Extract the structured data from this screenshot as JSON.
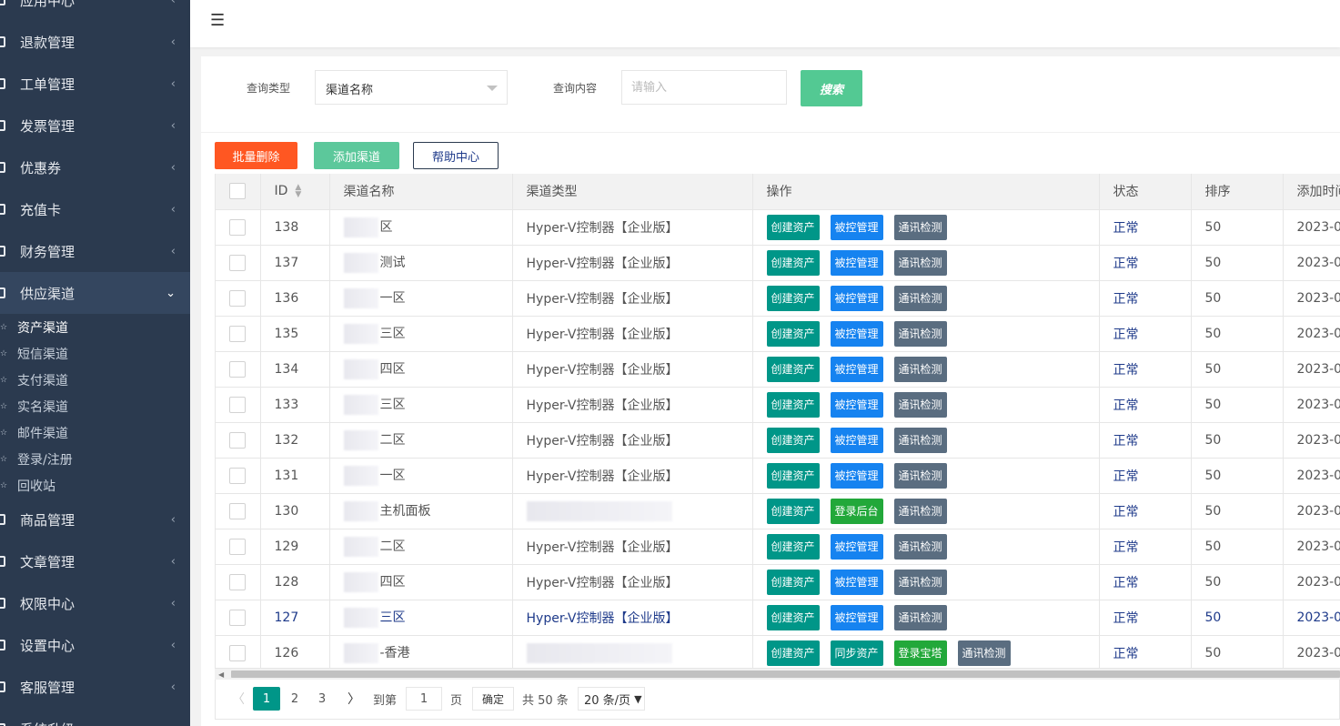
{
  "sidebar": {
    "items": [
      {
        "label": "应用中心"
      },
      {
        "label": "退款管理"
      },
      {
        "label": "工单管理"
      },
      {
        "label": "发票管理"
      },
      {
        "label": "优惠券"
      },
      {
        "label": "充值卡"
      },
      {
        "label": "财务管理"
      },
      {
        "label": "供应渠道"
      },
      {
        "label": "商品管理"
      },
      {
        "label": "文章管理"
      },
      {
        "label": "权限中心"
      },
      {
        "label": "设置中心"
      },
      {
        "label": "客服管理"
      },
      {
        "label": "系统升级"
      }
    ],
    "sub_items": [
      {
        "label": "资产渠道"
      },
      {
        "label": "短信渠道"
      },
      {
        "label": "支付渠道"
      },
      {
        "label": "实名渠道"
      },
      {
        "label": "邮件渠道"
      },
      {
        "label": "登录/注册"
      },
      {
        "label": "回收站"
      }
    ]
  },
  "header": {
    "menu_icon": "hamburger-icon"
  },
  "search": {
    "type_label": "查询类型",
    "type_value": "渠道名称",
    "content_label": "查询内容",
    "content_placeholder": "请输入",
    "search_button": "搜索"
  },
  "toolbar": {
    "batch_delete": "批量删除",
    "add_channel": "添加渠道",
    "help_center": "帮助中心"
  },
  "table": {
    "headers": [
      "ID",
      "渠道名称",
      "渠道类型",
      "操作",
      "状态",
      "排序",
      "添加时间"
    ],
    "rows": [
      {
        "id": "138",
        "name": "区",
        "type": "Hyper-V控制器【企业版】",
        "ops": [
          "创建资产",
          "被控管理",
          "通讯检测"
        ],
        "status": "正常",
        "sort": "50",
        "time": "2023-0"
      },
      {
        "id": "137",
        "name": "测试",
        "type": "Hyper-V控制器【企业版】",
        "ops": [
          "创建资产",
          "被控管理",
          "通讯检测"
        ],
        "status": "正常",
        "sort": "50",
        "time": "2023-0"
      },
      {
        "id": "136",
        "name": "一区",
        "type": "Hyper-V控制器【企业版】",
        "ops": [
          "创建资产",
          "被控管理",
          "通讯检测"
        ],
        "status": "正常",
        "sort": "50",
        "time": "2023-0"
      },
      {
        "id": "135",
        "name": "三区",
        "type": "Hyper-V控制器【企业版】",
        "ops": [
          "创建资产",
          "被控管理",
          "通讯检测"
        ],
        "status": "正常",
        "sort": "50",
        "time": "2023-0"
      },
      {
        "id": "134",
        "name": "四区",
        "type": "Hyper-V控制器【企业版】",
        "ops": [
          "创建资产",
          "被控管理",
          "通讯检测"
        ],
        "status": "正常",
        "sort": "50",
        "time": "2023-0"
      },
      {
        "id": "133",
        "name": "三区",
        "type": "Hyper-V控制器【企业版】",
        "ops": [
          "创建资产",
          "被控管理",
          "通讯检测"
        ],
        "status": "正常",
        "sort": "50",
        "time": "2023-0"
      },
      {
        "id": "132",
        "name": "二区",
        "type": "Hyper-V控制器【企业版】",
        "ops": [
          "创建资产",
          "被控管理",
          "通讯检测"
        ],
        "status": "正常",
        "sort": "50",
        "time": "2023-0"
      },
      {
        "id": "131",
        "name": "一区",
        "type": "Hyper-V控制器【企业版】",
        "ops": [
          "创建资产",
          "被控管理",
          "通讯检测"
        ],
        "status": "正常",
        "sort": "50",
        "time": "2023-0"
      },
      {
        "id": "130",
        "name": "主机面板",
        "type": "",
        "ops": [
          "创建资产",
          "登录后台",
          "通讯检测"
        ],
        "status": "正常",
        "sort": "50",
        "time": "2023-0"
      },
      {
        "id": "129",
        "name": "二区",
        "type": "Hyper-V控制器【企业版】",
        "ops": [
          "创建资产",
          "被控管理",
          "通讯检测"
        ],
        "status": "正常",
        "sort": "50",
        "time": "2023-0"
      },
      {
        "id": "128",
        "name": "四区",
        "type": "Hyper-V控制器【企业版】",
        "ops": [
          "创建资产",
          "被控管理",
          "通讯检测"
        ],
        "status": "正常",
        "sort": "50",
        "time": "2023-0"
      },
      {
        "id": "127",
        "name": "三区",
        "type": "Hyper-V控制器【企业版】",
        "ops": [
          "创建资产",
          "被控管理",
          "通讯检测"
        ],
        "status": "正常",
        "sort": "50",
        "time": "2023-0"
      },
      {
        "id": "126",
        "name": "-香港",
        "type": "",
        "ops": [
          "创建资产",
          "同步资产",
          "登录宝塔",
          "通讯检测"
        ],
        "status": "正常",
        "sort": "50",
        "time": "2023-0"
      }
    ]
  },
  "pagination": {
    "pages": [
      "1",
      "2",
      "3"
    ],
    "goto_label": "到第",
    "goto_value": "1",
    "page_label": "页",
    "confirm": "确定",
    "total": "共 50 条",
    "page_size": "20 条/页"
  },
  "colors": {
    "sidebar_bg": "#2b3a4f",
    "primary_teal": "#009688",
    "danger": "#ff5722",
    "success": "#5cc89b",
    "link_blue": "#1e3a8a"
  }
}
